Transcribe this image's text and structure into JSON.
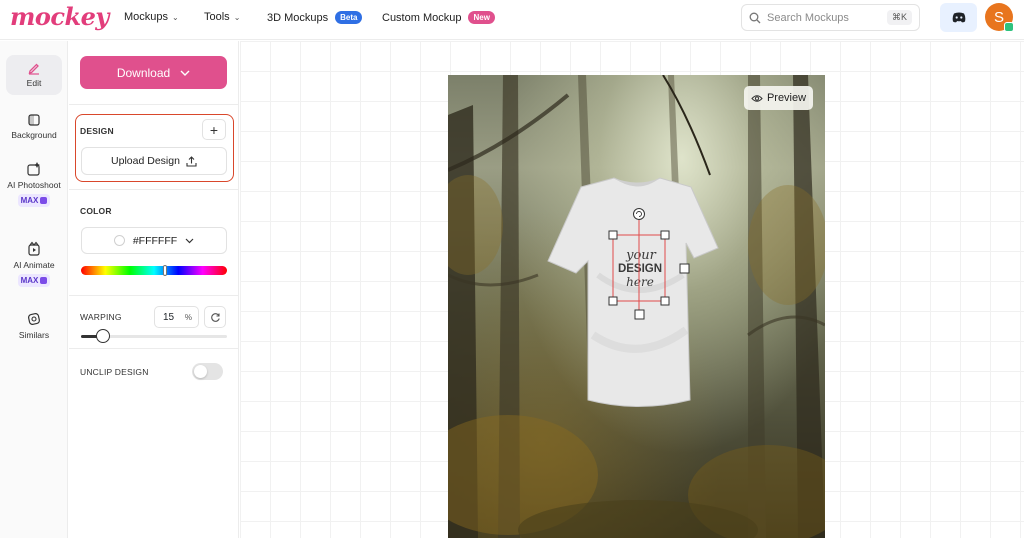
{
  "brand": {
    "logo_text": "mockey",
    "accent": "#e0508d"
  },
  "nav": {
    "mockups": "Mockups",
    "tools": "Tools",
    "mockups_3d": "3D Mockups",
    "beta_badge": "Beta",
    "custom": "Custom Mockup",
    "new_badge": "New"
  },
  "search": {
    "placeholder": "Search Mockups",
    "shortcut": "⌘K"
  },
  "user": {
    "initial": "S",
    "avatar_color": "#e8751e"
  },
  "rail": {
    "edit": "Edit",
    "background": "Background",
    "ai_photoshoot": "AI Photoshoot",
    "ai_photoshoot_badge": "MAX",
    "ai_animate": "AI Animate",
    "ai_animate_badge": "MAX",
    "similars": "Similars"
  },
  "panel": {
    "download": "Download",
    "design_label": "DESIGN",
    "upload_design": "Upload Design",
    "color_label": "COLOR",
    "color_value": "#FFFFFF",
    "warping_label": "WARPING",
    "warping_value": "15",
    "warping_unit": "%",
    "warping_fraction": 0.15,
    "unclip_label": "UNCLIP DESIGN",
    "unclip_on": false
  },
  "canvas": {
    "preview": "Preview",
    "design_lines": [
      "your",
      "DESIGN",
      "here"
    ]
  },
  "icons": [
    "chevron-down-icon",
    "search-icon",
    "discord-icon",
    "pencil-icon",
    "background-icon",
    "ai-photoshoot-icon",
    "ai-animate-icon",
    "similars-icon",
    "plus-icon",
    "upload-icon",
    "reset-icon",
    "eye-icon",
    "rotate-icon"
  ]
}
